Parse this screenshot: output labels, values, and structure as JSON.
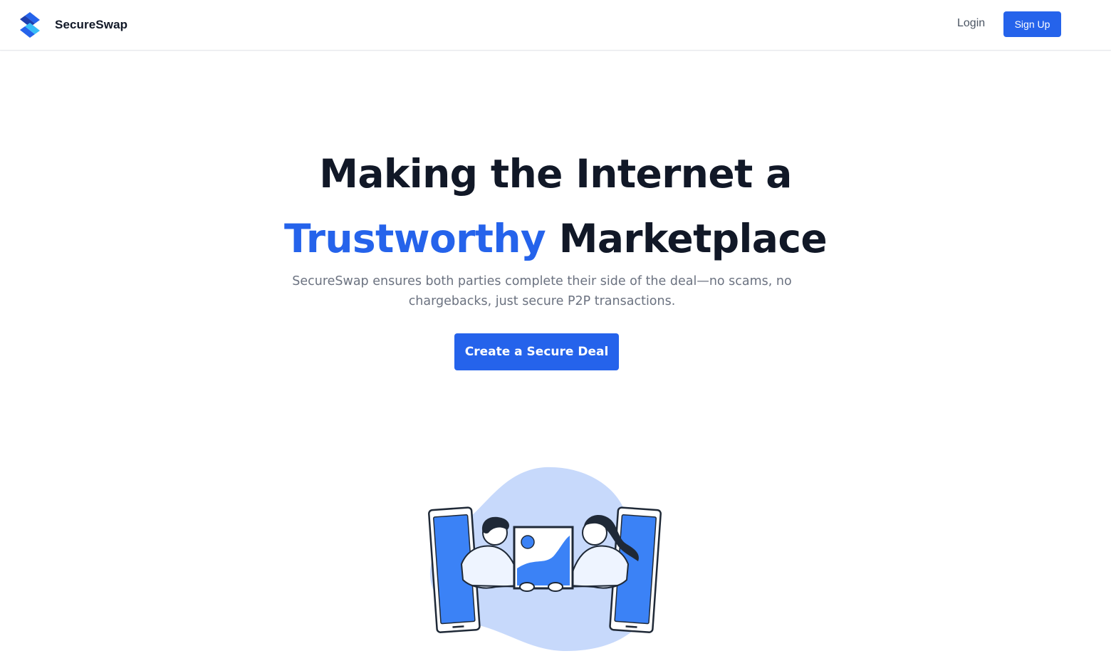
{
  "header": {
    "brand_name": "SecureSwap",
    "logo_icon": "secureswap-logo-icon",
    "login_label": "Login",
    "signup_label": "Sign Up"
  },
  "hero": {
    "title_line1": "Making the Internet a",
    "title_accent": "Trustworthy",
    "title_rest": " Marketplace",
    "subtitle": "SecureSwap ensures both parties complete their side of the deal—no scams, no chargebacks, just secure P2P transactions.",
    "cta_label": "Create a Secure Deal"
  },
  "colors": {
    "accent": "#2563eb",
    "heading": "#111827",
    "muted": "#6b7280",
    "illustration_blob": "#c7d9fb",
    "illustration_blue": "#3b82f6"
  },
  "illustration": {
    "icon": "phone-exchange-illustration"
  }
}
